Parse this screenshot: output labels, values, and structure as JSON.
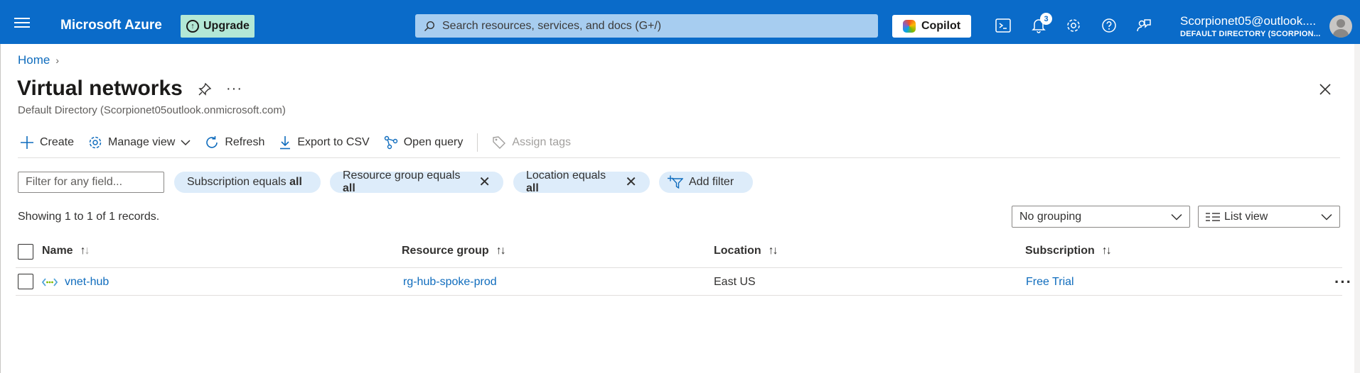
{
  "topbar": {
    "brand": "Microsoft Azure",
    "upgrade_label": "Upgrade",
    "search_placeholder": "Search resources, services, and docs (G+/)",
    "copilot_label": "Copilot",
    "notification_count": "3",
    "user": "Scorpionet05@outlook....",
    "directory": "DEFAULT DIRECTORY (SCORPION...",
    "icons": [
      "menu-icon",
      "upgrade-icon",
      "search-icon",
      "copilot-icon",
      "cloud-shell-icon",
      "bell-icon",
      "gear-icon",
      "help-icon",
      "feedback-icon",
      "avatar"
    ]
  },
  "breadcrumb": {
    "home": "Home"
  },
  "page": {
    "title": "Virtual networks",
    "subtitle": "Default Directory (Scorpionet05outlook.onmicrosoft.com)",
    "more": "···"
  },
  "toolbar": {
    "create": "Create",
    "manage_view": "Manage view",
    "refresh": "Refresh",
    "export_csv": "Export to CSV",
    "open_query": "Open query",
    "assign_tags": "Assign tags"
  },
  "filters": {
    "placeholder": "Filter for any field...",
    "subscription_prefix": "Subscription equals ",
    "subscription_value": "all",
    "resource_group_prefix": "Resource group equals ",
    "resource_group_value": "all",
    "location_prefix": "Location equals ",
    "location_value": "all",
    "add_filter": "Add filter"
  },
  "records_text": "Showing 1 to 1 of 1 records.",
  "grouping": "No grouping",
  "view": "List view",
  "table": {
    "columns": [
      "Name",
      "Resource group",
      "Location",
      "Subscription"
    ],
    "rows": [
      {
        "name": "vnet-hub",
        "resource_group": "rg-hub-spoke-prod",
        "location": "East US",
        "subscription": "Free Trial"
      }
    ]
  },
  "colors": {
    "topbar": "#0a6bc9",
    "link": "#0f6cbd",
    "pill": "#ddecfa",
    "upgrade": "#b3e8d6"
  }
}
